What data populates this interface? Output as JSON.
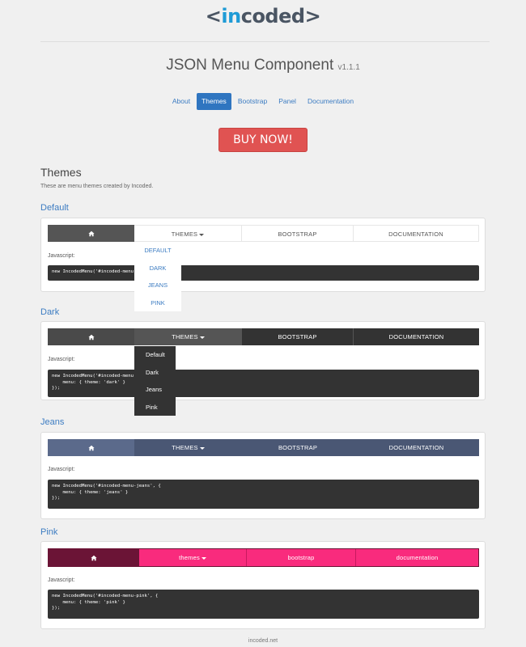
{
  "logo": {
    "open": "<",
    "part1": "in",
    "part2": "coded",
    "close": ">"
  },
  "header": {
    "title": "JSON Menu Component",
    "version": "v1.1.1"
  },
  "nav": {
    "items": [
      "About",
      "Themes",
      "Bootstrap",
      "Panel",
      "Documentation"
    ],
    "active": "Themes"
  },
  "buy_label": "BUY NOW!",
  "themes_section": {
    "title": "Themes",
    "description": "These are menu themes created by Incoded."
  },
  "js_label": "Javascript:",
  "themes": {
    "default": {
      "title": "Default",
      "menu": [
        "THEMES",
        "BOOTSTRAP",
        "DOCUMENTATION"
      ],
      "dropdown": [
        "DEFAULT",
        "DARK",
        "JEANS",
        "PINK"
      ],
      "code": "new IncodedMenu('#incoded-menu"
    },
    "dark": {
      "title": "Dark",
      "menu": [
        "THEMES",
        "BOOTSTRAP",
        "DOCUMENTATION"
      ],
      "dropdown": [
        "Default",
        "Dark",
        "Jeans",
        "Pink"
      ],
      "code": "new IncodedMenu('#incoded-menu-\n    menu: { theme: 'dark' }\n});"
    },
    "jeans": {
      "title": "Jeans",
      "menu": [
        "THEMES",
        "BOOTSTRAP",
        "DOCUMENTATION"
      ],
      "code": "new IncodedMenu('#incoded-menu-jeans', {\n    menu: { theme: 'jeans' }\n});"
    },
    "pink": {
      "title": "Pink",
      "menu": [
        "themes",
        "bootstrap",
        "documentation"
      ],
      "code": "new IncodedMenu('#incoded-menu-pink', {\n    menu: { theme: 'pink' }\n});"
    }
  },
  "footer": "incoded.net",
  "colors": {
    "brand_blue": "#1f9bd6",
    "link_blue": "#3c7cc2",
    "buy_red": "#e05352",
    "dark_menu": "#333333",
    "jeans_menu": "#4a5774",
    "pink_menu": "#f92b7d",
    "pink_home": "#6b1436"
  },
  "icons": {
    "home": "home-icon",
    "caret": "caret-down-icon"
  }
}
